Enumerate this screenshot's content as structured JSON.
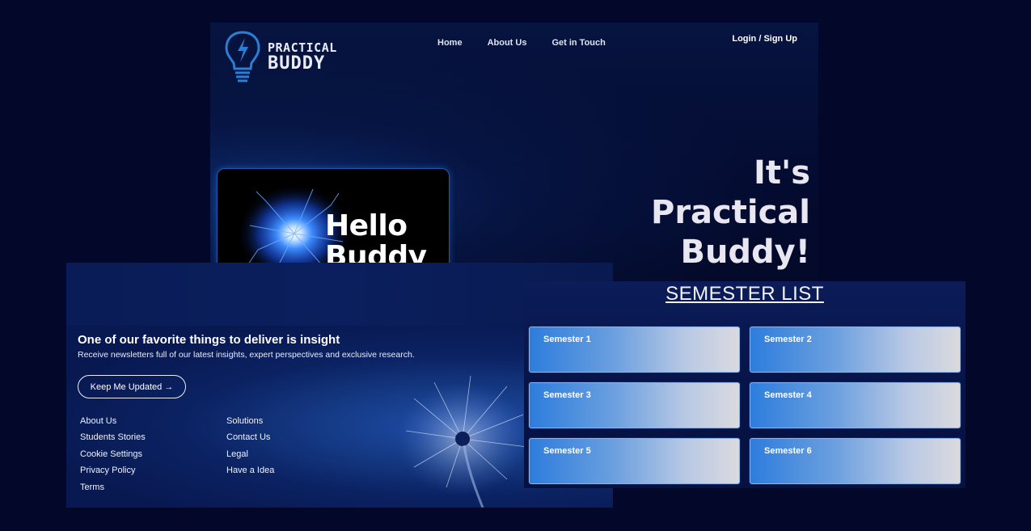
{
  "brand": {
    "line1": "PRACTICAL",
    "line2": "BUDDY"
  },
  "nav": {
    "items": [
      {
        "label": "Home"
      },
      {
        "label": "About Us"
      },
      {
        "label": "Get in Touch"
      }
    ],
    "login_label": "Login / Sign Up"
  },
  "hero": {
    "card": {
      "line1": "Hello",
      "line2": "Buddy"
    },
    "tagline": {
      "line1": "It's",
      "line2": "Practical",
      "line3": "Buddy!"
    }
  },
  "newsletter": {
    "title": "One of our favorite things to deliver is insight",
    "subtitle": "Receive newsletters full of our latest insights, expert perspectives and exclusive research.",
    "button_label": "Keep Me Updated →"
  },
  "footer": {
    "col1": [
      "About Us",
      "Students Stories",
      "Cookie Settings",
      "Privacy Policy",
      "Terms"
    ],
    "col2": [
      "Solutions",
      "Contact Us",
      "Legal",
      "Have a Idea"
    ]
  },
  "semester_list": {
    "title": "SEMESTER LIST",
    "items": [
      {
        "label": "Semester 1"
      },
      {
        "label": "Semester 2"
      },
      {
        "label": "Semester 3"
      },
      {
        "label": "Semester 4"
      },
      {
        "label": "Semester 5"
      },
      {
        "label": "Semester 6"
      }
    ]
  },
  "colors": {
    "page_bg": "#03082a",
    "accent_blue": "#2d7ddd",
    "logo_blue": "#2a7fd4"
  },
  "icons": {
    "logo": "lightbulb-bolt-icon",
    "arrow": "arrow-right-icon"
  }
}
